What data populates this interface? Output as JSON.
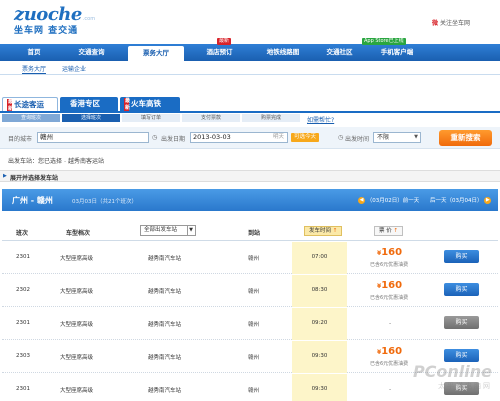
{
  "header": {
    "logo_en": "zuoche",
    "logo_dot": ".com",
    "logo_cn": "坐车网 查交通",
    "follow": "关注坐车网",
    "weibo_glyph": "微"
  },
  "nav": {
    "items": [
      {
        "label": "首页"
      },
      {
        "label": "交通查询"
      },
      {
        "label": "票务大厅"
      },
      {
        "label": "酒店预订",
        "badge": "最新"
      },
      {
        "label": "地铁线路图"
      },
      {
        "label": "交通社区"
      },
      {
        "label": "手机客户端",
        "badge": "App Store已上线"
      }
    ],
    "sub": [
      "票务大厅",
      "运输企业"
    ]
  },
  "modes": [
    {
      "label": "长途客运",
      "tag": "最新"
    },
    {
      "label": "香港专区"
    },
    {
      "label": "火车高铁",
      "tag": "最新"
    }
  ],
  "steps": [
    "查询班次",
    "选择班次",
    "填写订单",
    "支付票款",
    "购票完成"
  ],
  "help_link": "如需帮忙?",
  "search": {
    "origin_label": "目的城市",
    "origin_value": "赣州",
    "date_label": "出发日期",
    "date_value": "2013-03-03",
    "date_hint": "明天",
    "today_badge": "可选今天",
    "time_label": "出发时间",
    "time_value": "不限",
    "button": "重新搜索"
  },
  "station_row": {
    "label": "出发车站：",
    "text": "您已选择",
    "value": "越秀南客运站"
  },
  "expand_bar": "展开并选择发车站",
  "route": {
    "title": "广州 - 赣州",
    "sub": "03月03日（共21个班次）",
    "prev": "（03月02日）前一天",
    "next": "后一天（03月04日）"
  },
  "table": {
    "headers": {
      "trip": "班次",
      "vehicle": "车型档次",
      "station_select": "全部出发车站",
      "dest": "到站",
      "time_btn": "发车时间",
      "price_btn": "票 价"
    },
    "rows": [
      {
        "trip": "2301",
        "vehicle": "大型座席高级",
        "station": "越秀南汽车站",
        "dest": "赣州",
        "time": "07:00",
        "price": "160",
        "discount": "已含6元优惠油费",
        "buy": "购买",
        "available": true
      },
      {
        "trip": "2302",
        "vehicle": "大型座席高级",
        "station": "越秀南汽车站",
        "dest": "赣州",
        "time": "08:30",
        "price": "160",
        "discount": "已含6元优惠油费",
        "buy": "购买",
        "available": true
      },
      {
        "trip": "2301",
        "vehicle": "大型座席高级",
        "station": "越秀南汽车站",
        "dest": "赣州",
        "time": "09:20",
        "price": "-",
        "discount": "",
        "buy": "购买",
        "available": false
      },
      {
        "trip": "2303",
        "vehicle": "大型座席高级",
        "station": "越秀南汽车站",
        "dest": "赣州",
        "time": "09:30",
        "price": "160",
        "discount": "已含6元优惠油费",
        "buy": "购买",
        "available": true
      },
      {
        "trip": "2301",
        "vehicle": "大型座席高级",
        "station": "越秀南汽车站",
        "dest": "赣州",
        "time": "09:30",
        "price": "-",
        "discount": "",
        "buy": "购买",
        "available": false
      }
    ]
  },
  "watermark": {
    "big": "PConline",
    "small": "太平洋电脑网"
  },
  "colors": {
    "brand_blue": "#1a5fb0",
    "accent_orange": "#f06a0c",
    "time_highlight": "#fdf5c9"
  }
}
